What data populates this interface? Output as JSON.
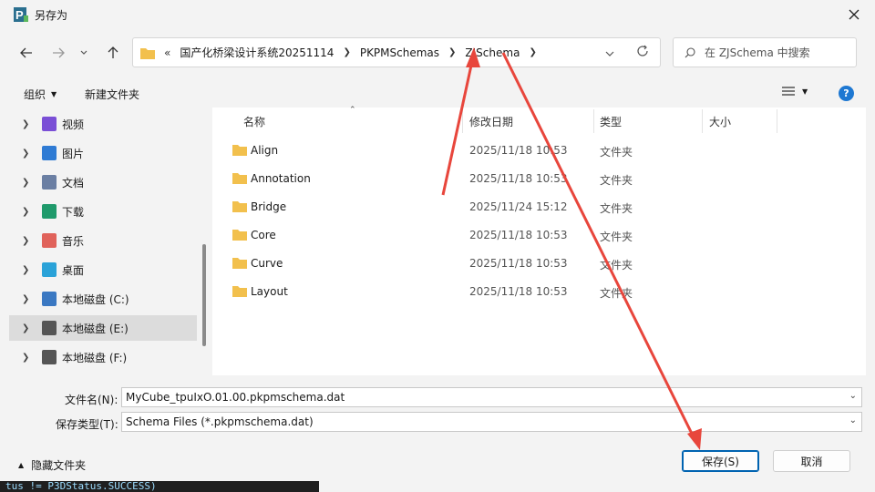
{
  "window": {
    "title": "另存为"
  },
  "nav": {
    "breadcrumbs": [
      "国产化桥梁设计系统20251114",
      "PKPMSchemas",
      "ZJSchema"
    ],
    "overflow": "«",
    "search_placeholder": "在 ZJSchema 中搜索"
  },
  "toolbar": {
    "organize_label": "组织",
    "new_folder_label": "新建文件夹"
  },
  "sidebar": {
    "items": [
      {
        "label": "视频",
        "icon": "video-icon",
        "color": "#7a4fd6"
      },
      {
        "label": "图片",
        "icon": "picture-icon",
        "color": "#2f7bd4"
      },
      {
        "label": "文档",
        "icon": "document-icon",
        "color": "#6b7fa3"
      },
      {
        "label": "下载",
        "icon": "download-icon",
        "color": "#1f9a6b"
      },
      {
        "label": "音乐",
        "icon": "music-icon",
        "color": "#e0625a"
      },
      {
        "label": "桌面",
        "icon": "desktop-icon",
        "color": "#2aa2d8"
      },
      {
        "label": "本地磁盘 (C:)",
        "icon": "windows-drive-icon",
        "color": "#3a78c2"
      },
      {
        "label": "本地磁盘 (E:)",
        "icon": "drive-icon",
        "color": "#555555"
      },
      {
        "label": "本地磁盘 (F:)",
        "icon": "drive-icon",
        "color": "#555555"
      }
    ],
    "selected_index": 7
  },
  "files": {
    "columns": [
      "名称",
      "修改日期",
      "类型",
      "大小"
    ],
    "rows": [
      {
        "name": "Align",
        "date": "2025/11/18 10:53",
        "type": "文件夹"
      },
      {
        "name": "Annotation",
        "date": "2025/11/18 10:53",
        "type": "文件夹"
      },
      {
        "name": "Bridge",
        "date": "2025/11/24 15:12",
        "type": "文件夹"
      },
      {
        "name": "Core",
        "date": "2025/11/18 10:53",
        "type": "文件夹"
      },
      {
        "name": "Curve",
        "date": "2025/11/18 10:53",
        "type": "文件夹"
      },
      {
        "name": "Layout",
        "date": "2025/11/18 10:53",
        "type": "文件夹"
      }
    ]
  },
  "form": {
    "filename_label": "文件名(N):",
    "filename_value": "MyCube_tpuIxO.01.00.pkpmschema.dat",
    "filetype_label": "保存类型(T):",
    "filetype_value": "Schema Files (*.pkpmschema.dat)"
  },
  "footer": {
    "hide_folders_label": "隐藏文件夹",
    "save_label": "保存(S)",
    "cancel_label": "取消"
  },
  "background_code": "tus != P3DStatus.SUCCESS)",
  "colors": {
    "accent": "#0063b1",
    "folder": "#f2c04d",
    "annotation": "#e8463c"
  }
}
